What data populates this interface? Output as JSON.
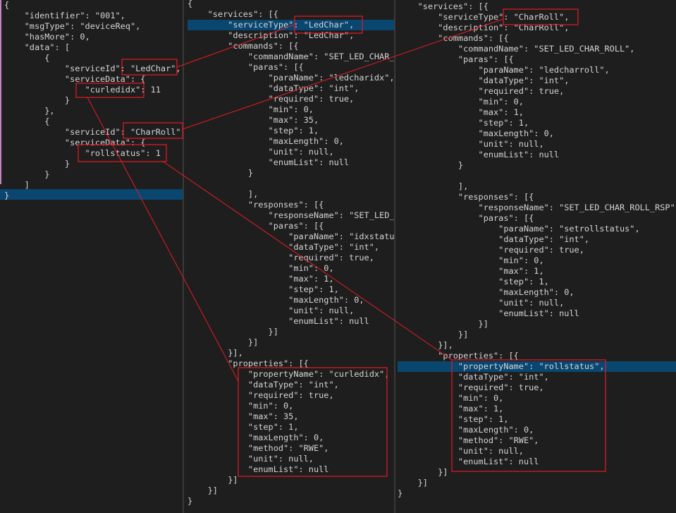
{
  "panes": {
    "left": {
      "lines": [
        "{",
        "    \"identifier\": \"001\",",
        "    \"msgType\": \"deviceReq\",",
        "    \"hasMore\": 0,",
        "    \"data\": [",
        "        {",
        "            \"serviceId\": \"LedChar\",",
        "            \"serviceData\": {",
        "                \"curledidx\": 11",
        "            }",
        "        },",
        "        {",
        "            \"serviceId\": \"CharRoll\",",
        "            \"serviceData\": {",
        "                \"rollstatus\": 1",
        "            }",
        "        }",
        "    ]",
        "}"
      ]
    },
    "middle": {
      "lines": [
        "{",
        "    \"services\": [{",
        "        \"serviceType\": \"LedChar\",",
        "        \"description\": \"LedChar\",",
        "        \"commands\": [{",
        "            \"commandName\": \"SET_LED_CHAR_I",
        "            \"paras\": [{",
        "                \"paraName\": \"ledcharidx\",",
        "                \"dataType\": \"int\",",
        "                \"required\": true,",
        "                \"min\": 0,",
        "                \"max\": 35,",
        "                \"step\": 1,",
        "                \"maxLength\": 0,",
        "                \"unit\": null,",
        "                \"enumList\": null",
        "            }",
        "",
        "            ],",
        "            \"responses\": [{",
        "                \"responseName\": \"SET_LED_C",
        "                \"paras\": [{",
        "                    \"paraName\": \"idxstatus",
        "                    \"dataType\": \"int\",",
        "                    \"required\": true,",
        "                    \"min\": 0,",
        "                    \"max\": 1,",
        "                    \"step\": 1,",
        "                    \"maxLength\": 0,",
        "                    \"unit\": null,",
        "                    \"enumList\": null",
        "                }]",
        "            }]",
        "        }],",
        "        \"properties\": [{",
        "            \"propertyName\": \"curledidx\",",
        "            \"dataType\": \"int\",",
        "            \"required\": true,",
        "            \"min\": 0,",
        "            \"max\": 35,",
        "            \"step\": 1,",
        "            \"maxLength\": 0,",
        "            \"method\": \"RWE\",",
        "            \"unit\": null,",
        "            \"enumList\": null",
        "        }]",
        "    }]",
        "}"
      ]
    },
    "right": {
      "lines": [
        "    \"services\": [{",
        "        \"serviceType\": \"CharRoll\",",
        "        \"description\": \"CharRoll\",",
        "        \"commands\": [{",
        "            \"commandName\": \"SET_LED_CHAR_ROLL\",",
        "            \"paras\": [{",
        "                \"paraName\": \"ledcharroll\",",
        "                \"dataType\": \"int\",",
        "                \"required\": true,",
        "                \"min\": 0,",
        "                \"max\": 1,",
        "                \"step\": 1,",
        "                \"maxLength\": 0,",
        "                \"unit\": null,",
        "                \"enumList\": null",
        "            }",
        "",
        "            ],",
        "            \"responses\": [{",
        "                \"responseName\": \"SET_LED_CHAR_ROLL_RSP\",",
        "                \"paras\": [{",
        "                    \"paraName\": \"setrollstatus\",",
        "                    \"dataType\": \"int\",",
        "                    \"required\": true,",
        "                    \"min\": 0,",
        "                    \"max\": 1,",
        "                    \"step\": 1,",
        "                    \"maxLength\": 0,",
        "                    \"unit\": null,",
        "                    \"enumList\": null",
        "                }]",
        "            }]",
        "        }],",
        "        \"properties\": [{",
        "            \"propertyName\": \"rollstatus\",",
        "            \"dataType\": \"int\",",
        "            \"required\": true,",
        "            \"min\": 0,",
        "            \"max\": 1,",
        "            \"step\": 1,",
        "            \"maxLength\": 0,",
        "            \"method\": \"RWE\",",
        "            \"unit\": null,",
        "            \"enumList\": null",
        "        }]",
        "    }]",
        "}"
      ]
    }
  },
  "colors": {
    "annotation": "#e51c23",
    "line_highlight": "#094771",
    "background": "#1e1e1e"
  }
}
